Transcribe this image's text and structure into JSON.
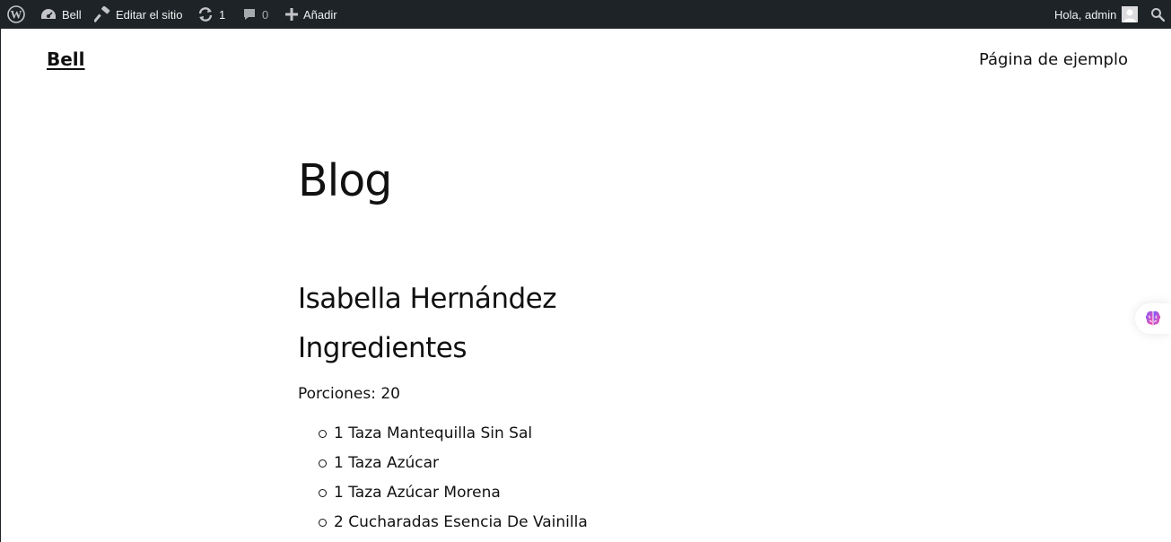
{
  "admin_bar": {
    "site_name": "Bell",
    "edit_site_label": "Editar el sitio",
    "updates_count": "1",
    "comments_count": "0",
    "new_label": "Añadir",
    "greeting": "Hola, admin",
    "icons": {
      "wordpress": "wordpress-logo-icon",
      "dashboard": "dashboard-gauge-icon",
      "edit": "hammer-edit-icon",
      "updates": "refresh-updates-icon",
      "comments": "comment-bubble-icon",
      "add": "plus-icon",
      "avatar": "user-avatar-icon",
      "search": "search-icon"
    }
  },
  "header": {
    "site_title": "Bell",
    "nav_items": [
      "Página de ejemplo"
    ]
  },
  "main": {
    "page_title": "Blog",
    "post_title": "Isabella Hernández",
    "section_heading": "Ingredientes",
    "servings": "Porciones: 20",
    "ingredients": [
      "1 Taza Mantequilla Sin Sal",
      "1 Taza Azúcar",
      "1 Taza Azúcar Morena",
      "2 Cucharadas Esencia De Vainilla"
    ]
  },
  "floating_widget": {
    "icon": "brain-icon"
  }
}
